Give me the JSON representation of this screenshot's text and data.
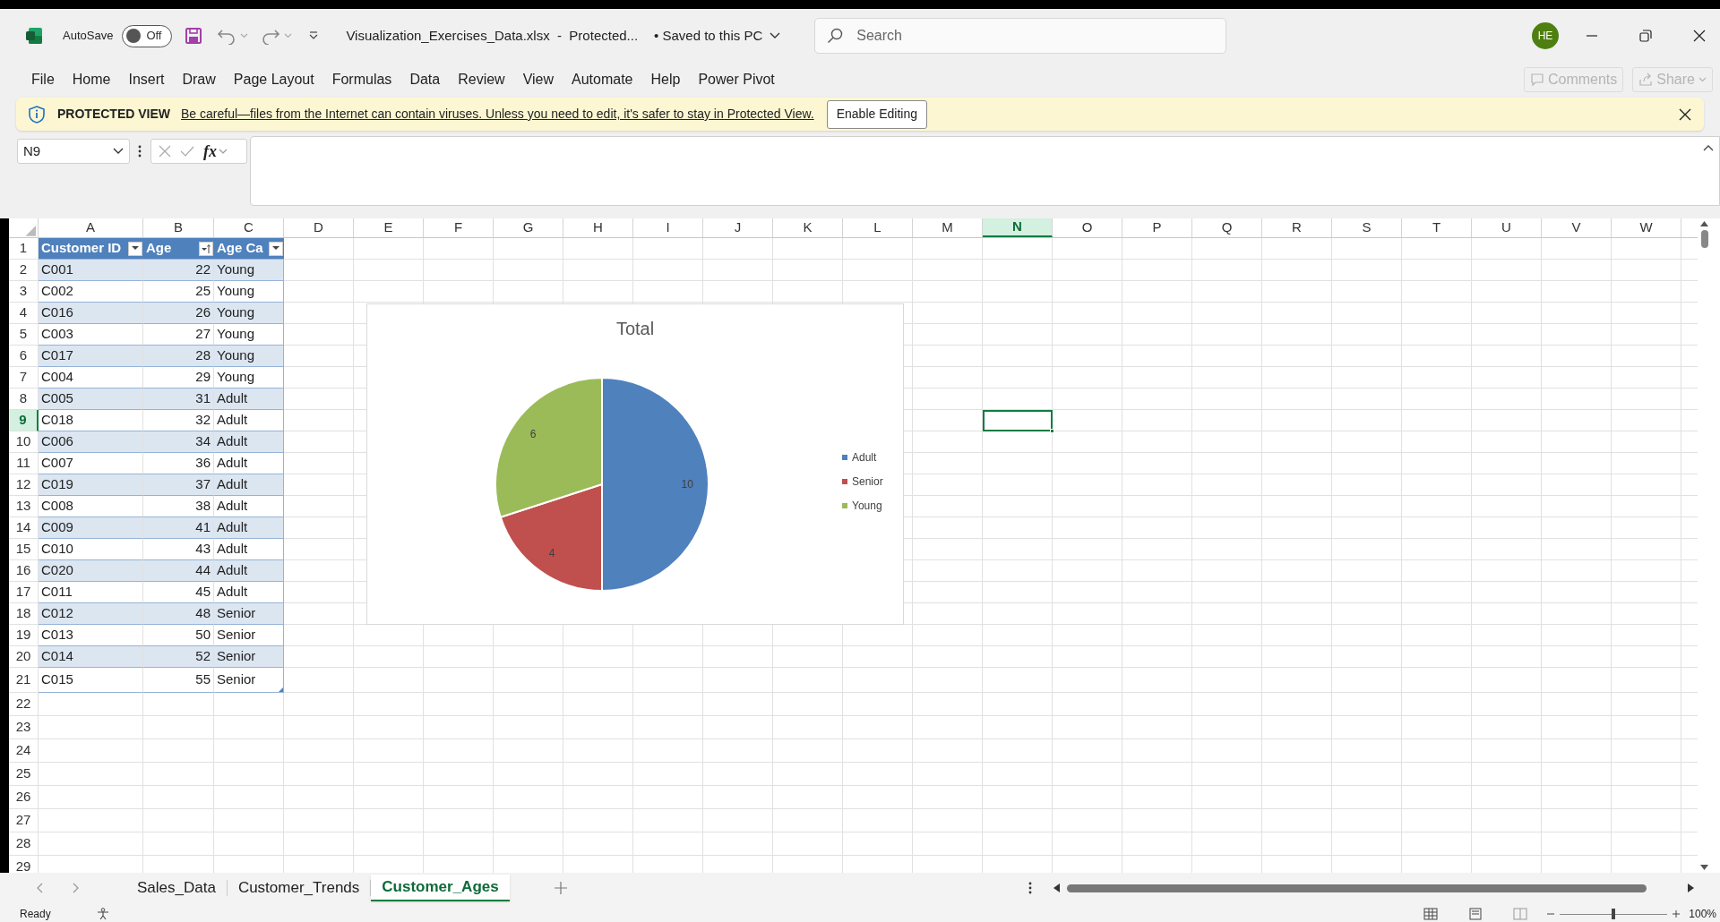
{
  "title_bar": {
    "autosave_label": "AutoSave",
    "autosave": {
      "label": "Off",
      "on": false
    },
    "file_name": "Visualization_Exercises_Data.xlsx  -  Protected...",
    "save_status": "• Saved to this PC",
    "search": {
      "placeholder": "Search"
    },
    "avatar": "HE"
  },
  "ribbon_tabs": [
    "File",
    "Home",
    "Insert",
    "Draw",
    "Page Layout",
    "Formulas",
    "Data",
    "Review",
    "View",
    "Automate",
    "Help",
    "Power Pivot"
  ],
  "ribbon_buttons": [
    {
      "label": "Comments",
      "disabled": true
    },
    {
      "label": "Share",
      "disabled": true
    }
  ],
  "message_bar": {
    "label": "PROTECTED VIEW",
    "message": "Be careful—files from the Internet can contain viruses. Unless you need to edit, it's safer to stay in Protected View.",
    "button": "Enable Editing"
  },
  "formula_bar": {
    "name_box": "N9",
    "fx_label": "fx"
  },
  "columns": [
    {
      "label": "A",
      "selected": false
    },
    {
      "label": "B",
      "selected": false
    },
    {
      "label": "C",
      "selected": false
    },
    {
      "label": "D",
      "selected": false
    },
    {
      "label": "E",
      "selected": false
    },
    {
      "label": "F",
      "selected": false
    },
    {
      "label": "G",
      "selected": false
    },
    {
      "label": "H",
      "selected": false
    },
    {
      "label": "I",
      "selected": false
    },
    {
      "label": "J",
      "selected": false
    },
    {
      "label": "K",
      "selected": false
    },
    {
      "label": "L",
      "selected": false
    },
    {
      "label": "M",
      "selected": false
    },
    {
      "label": "N",
      "selected": true
    },
    {
      "label": "O",
      "selected": false
    },
    {
      "label": "P",
      "selected": false
    },
    {
      "label": "Q",
      "selected": false
    },
    {
      "label": "R",
      "selected": false
    },
    {
      "label": "S",
      "selected": false
    },
    {
      "label": "T",
      "selected": false
    },
    {
      "label": "U",
      "selected": false
    },
    {
      "label": "V",
      "selected": false
    },
    {
      "label": "W",
      "selected": false
    }
  ],
  "row_headers": [
    {
      "label": "1",
      "selected": false
    },
    {
      "label": "2",
      "selected": false
    },
    {
      "label": "3",
      "selected": false
    },
    {
      "label": "4",
      "selected": false
    },
    {
      "label": "5",
      "selected": false
    },
    {
      "label": "6",
      "selected": false
    },
    {
      "label": "7",
      "selected": false
    },
    {
      "label": "8",
      "selected": false
    },
    {
      "label": "9",
      "selected": true
    },
    {
      "label": "10",
      "selected": false
    },
    {
      "label": "11",
      "selected": false
    },
    {
      "label": "12",
      "selected": false
    },
    {
      "label": "13",
      "selected": false
    },
    {
      "label": "14",
      "selected": false
    },
    {
      "label": "15",
      "selected": false
    },
    {
      "label": "16",
      "selected": false
    },
    {
      "label": "17",
      "selected": false
    },
    {
      "label": "18",
      "selected": false
    },
    {
      "label": "19",
      "selected": false
    },
    {
      "label": "20",
      "selected": false
    },
    {
      "label": "21",
      "selected": false
    },
    {
      "label": "22",
      "selected": false
    },
    {
      "label": "23",
      "selected": false
    },
    {
      "label": "24",
      "selected": false
    },
    {
      "label": "25",
      "selected": false
    },
    {
      "label": "26",
      "selected": false
    },
    {
      "label": "27",
      "selected": false
    },
    {
      "label": "28",
      "selected": false
    },
    {
      "label": "29",
      "selected": false
    }
  ],
  "table": {
    "columns": [
      {
        "label": "Customer ID",
        "sorted": false
      },
      {
        "label": "Age",
        "sorted": true
      },
      {
        "label": "Age Ca",
        "sorted": false
      }
    ],
    "rows": [
      [
        "C001",
        "22",
        "Young"
      ],
      [
        "C002",
        "25",
        "Young"
      ],
      [
        "C016",
        "26",
        "Young"
      ],
      [
        "C003",
        "27",
        "Young"
      ],
      [
        "C017",
        "28",
        "Young"
      ],
      [
        "C004",
        "29",
        "Young"
      ],
      [
        "C005",
        "31",
        "Adult"
      ],
      [
        "C018",
        "32",
        "Adult"
      ],
      [
        "C006",
        "34",
        "Adult"
      ],
      [
        "C007",
        "36",
        "Adult"
      ],
      [
        "C019",
        "37",
        "Adult"
      ],
      [
        "C008",
        "38",
        "Adult"
      ],
      [
        "C009",
        "41",
        "Adult"
      ],
      [
        "C010",
        "43",
        "Adult"
      ],
      [
        "C020",
        "44",
        "Adult"
      ],
      [
        "C011",
        "45",
        "Adult"
      ],
      [
        "C012",
        "48",
        "Senior"
      ],
      [
        "C013",
        "50",
        "Senior"
      ],
      [
        "C014",
        "52",
        "Senior"
      ],
      [
        "C015",
        "55",
        "Senior"
      ]
    ]
  },
  "chart": {
    "chart_data": {
      "type": "pie",
      "title": "Total",
      "categories": [
        "Adult",
        "Senior",
        "Young"
      ],
      "values": [
        10,
        4,
        6
      ],
      "data_labels": true,
      "legend": "right"
    }
  },
  "sheet_tabs": [
    {
      "label": "Sales_Data",
      "selected": false
    },
    {
      "label": "Customer_Trends",
      "selected": false
    },
    {
      "label": "Customer_Ages",
      "selected": true
    }
  ],
  "status_bar": {
    "status": "Ready",
    "zoom": {
      "level": 0.5,
      "reading": "100%"
    }
  }
}
